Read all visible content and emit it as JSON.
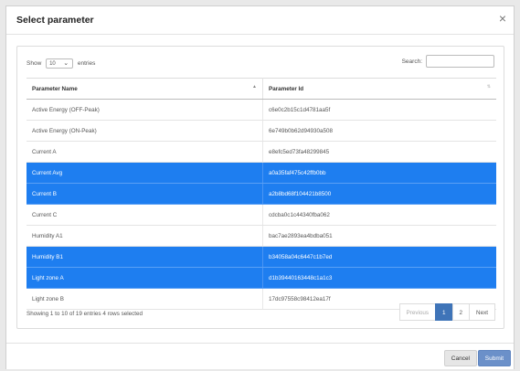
{
  "modal": {
    "title": "Select parameter",
    "close_glyph": "×"
  },
  "length": {
    "show_label": "Show",
    "value": "10",
    "entries_label": "entries"
  },
  "search": {
    "label": "Search:",
    "placeholder": ""
  },
  "table": {
    "headers": [
      "Parameter Name",
      "Parameter Id"
    ],
    "rows": [
      {
        "name": "Active Energy (OFF-Peak)",
        "id": "c6e0c2b15c1d4781aa5f",
        "selected": false
      },
      {
        "name": "Active Energy (ON-Peak)",
        "id": "6e749b0b62d94930a508",
        "selected": false
      },
      {
        "name": "Current A",
        "id": "e8efc5ed73fa48299845",
        "selected": false
      },
      {
        "name": "Current Avg",
        "id": "a0a35faf475c42ffb0bb",
        "selected": true
      },
      {
        "name": "Current B",
        "id": "a2b8bd68f104421b8500",
        "selected": true
      },
      {
        "name": "Current C",
        "id": "cdcba0c1c44340fba062",
        "selected": false
      },
      {
        "name": "Humidity A1",
        "id": "bac7ae2893ea4bdba051",
        "selected": false
      },
      {
        "name": "Humidity B1",
        "id": "b34058a04c6447c1b7ed",
        "selected": true
      },
      {
        "name": "Light zone A",
        "id": "d1b39440163448c1a1c3",
        "selected": true
      },
      {
        "name": "Light zone B",
        "id": "17dc97558c98412ea17f",
        "selected": false
      }
    ]
  },
  "info": "Showing 1 to 10 of 19 entries   4 rows selected",
  "pager": {
    "previous": "Previous",
    "page1": "1",
    "page2": "2",
    "next": "Next"
  },
  "footer": {
    "cancel": "Cancel",
    "submit": "Submit"
  },
  "colors": {
    "selected_row": "#1e7ef0",
    "submit": "#6b90c9",
    "page_active": "#3f74b8"
  }
}
